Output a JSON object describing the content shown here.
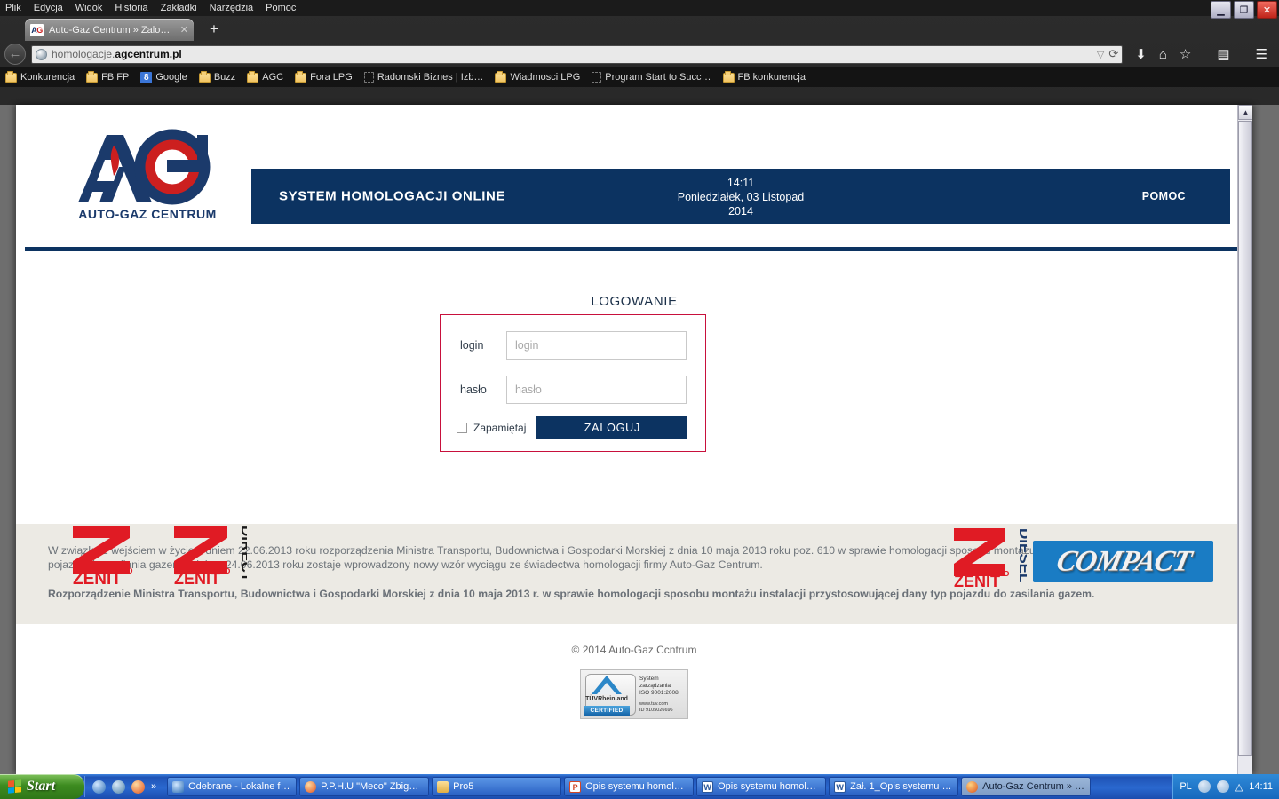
{
  "browser": {
    "menus": [
      "Plik",
      "Edycja",
      "Widok",
      "Historia",
      "Zakładki",
      "Narzędzia",
      "Pomoc"
    ],
    "window_controls": {
      "minimize": "—",
      "restore": "❐",
      "close": "✕"
    },
    "tab": {
      "favicon_a": "A",
      "favicon_g": "G",
      "title": "Auto-Gaz Centrum » Zaloguj się",
      "close": "✕"
    },
    "new_tab_label": "+",
    "back_label": "←",
    "url_prefix": "homologacje.",
    "url_domain": "agcentrum.pl",
    "url_dropdown": "▽",
    "url_reload": "⟳",
    "nav_icons": [
      "download-icon",
      "home-icon",
      "bookmark-star-icon",
      "reader-icon",
      "menu-icon"
    ],
    "bookmarks": [
      {
        "label": "Konkurencja",
        "icon": "folder-icon"
      },
      {
        "label": "FB FP",
        "icon": "folder-icon"
      },
      {
        "label": "Google",
        "icon": "google-icon"
      },
      {
        "label": "Buzz",
        "icon": "folder-icon"
      },
      {
        "label": "AGC",
        "icon": "folder-icon"
      },
      {
        "label": "Fora LPG",
        "icon": "folder-icon"
      },
      {
        "label": "Radomski Biznes | Izb…",
        "icon": "page-icon"
      },
      {
        "label": "Wiadmosci LPG",
        "icon": "folder-icon"
      },
      {
        "label": "Program Start to Succ…",
        "icon": "page-icon"
      },
      {
        "label": "FB konkurencja",
        "icon": "folder-icon"
      }
    ]
  },
  "page": {
    "logo_alt": "AG Auto-Gaz Centrum",
    "logo_caption": "AUTO-GAZ CENTRUM",
    "banner": {
      "title": "SYSTEM HOMOLOGACJI ONLINE",
      "time": "14:11",
      "date_line": "Poniedziałek, 03 Listopad",
      "year": "2014",
      "help": "POMOC",
      "bg_color": "#0c3361"
    },
    "login": {
      "heading": "LOGOWANIE",
      "login_label": "login",
      "login_placeholder": "login",
      "login_value": "",
      "password_label": "hasło",
      "password_placeholder": "hasło",
      "password_value": "",
      "remember_label": "Zapamiętaj",
      "remember_checked": false,
      "submit_label": "ZALOGUJ",
      "border_color": "#c8103c",
      "button_color": "#0c3361"
    },
    "brands": [
      {
        "name": "ZENIT PRO",
        "word": "ZENIT",
        "sup": "PRO",
        "side": "",
        "color": "#e01b24"
      },
      {
        "name": "ZENIT PRO DIRECT",
        "word": "ZENIT",
        "sup": "PRO",
        "side": "DIRECT",
        "color": "#e01b24"
      },
      {
        "name": "ZENIT PRO DIESEL",
        "word": "ZENIT",
        "sup": "PRO",
        "side": "DIESEL",
        "color": "#e01b24"
      },
      {
        "name": "COMPACT",
        "word": "COMPACT",
        "color": "#1a7cc4"
      }
    ],
    "info": {
      "paragraph_1": "W związku z wejściem w życie z dniem 22.06.2013 roku rozporządzenia Ministra Transportu, Budownictwa i Gospodarki Morskiej z dnia 10 maja 2013 roku poz. 610 w sprawie homologacji sposobu montażu instalacji przystosowującej dany typ pojazdu do zasilania gazem z dniem 24.06.2013 roku zostaje wprowadzony nowy wzór wyciągu ze świadectwa homologacji firmy Auto-Gaz Centrum.",
      "paragraph_2": "Rozporządzenie Ministra Transportu, Budownictwa i Gospodarki Morskiej z dnia 10 maja 2013 r. w sprawie homologacji sposobu montażu instalacji przystosowującej dany typ pojazdu do zasilania gazem.",
      "bg_color": "#eceae4"
    },
    "footer": {
      "copyright": "© 2014 Auto-Gaz Ccntrum",
      "tuv": {
        "brand": "TÜVRheinland",
        "certified": "CERTIFIED",
        "iso_line1": "System",
        "iso_line2": "zarządzania",
        "iso_line3": "ISO 9001:2008",
        "www_line1": "www.tuv.com",
        "www_line2": "ID 9105026696"
      }
    }
  },
  "taskbar": {
    "start_label": "Start",
    "quicklaunch_more": "»",
    "items": [
      {
        "label": "Odebrane - Lokalne f…",
        "icon": "mail-icon",
        "active": false
      },
      {
        "label": "P.P.H.U \"Meco\" Zbig…",
        "icon": "chrome-icon",
        "active": false
      },
      {
        "label": "Pro5",
        "icon": "folder-icon",
        "active": false
      },
      {
        "label": "Opis systemu homolo…",
        "icon": "powerpoint-icon",
        "active": false
      },
      {
        "label": "Opis systemu homolo…",
        "icon": "word-icon",
        "active": false
      },
      {
        "label": "Zał. 1_Opis systemu …",
        "icon": "word-icon",
        "active": false
      },
      {
        "label": "Auto-Gaz Centrum » …",
        "icon": "firefox-icon",
        "active": true
      }
    ],
    "language": "PL",
    "clock": "14:11"
  }
}
